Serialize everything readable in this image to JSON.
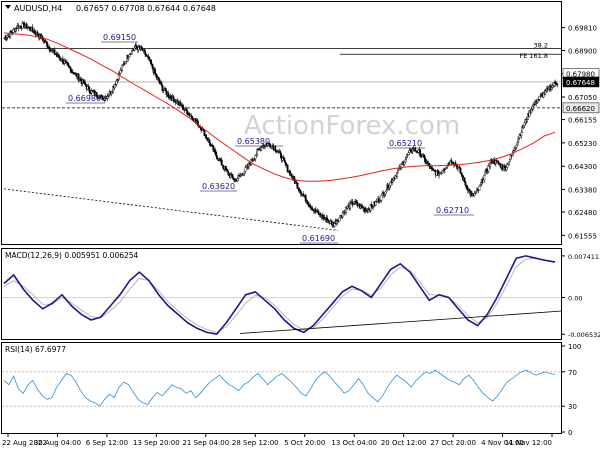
{
  "header": {
    "symbol": "AUDUSD,H4",
    "ohlc": "0.67657 0.67708 0.67644 0.67648"
  },
  "watermark": "ActionForex.com",
  "chart_data": [
    {
      "type": "candlestick",
      "panel": "price",
      "ylim": [
        0.6125,
        0.7035
      ],
      "x_ticks": [
        "22 Aug 2022",
        "30 Aug 04:00",
        "6 Sep 12:00",
        "13 Sep 20:00",
        "21 Sep 04:00",
        "28 Sep 12:00",
        "5 Oct 20:00",
        "13 Oct 04:00",
        "20 Oct 12:00",
        "27 Oct 20:00",
        "4 Nov 04:00",
        "11 Nov 12:00"
      ],
      "y_ticks": [
        "0.69810",
        "0.68900",
        "0.67980",
        "0.67050",
        "0.66155",
        "0.65230",
        "0.64300",
        "0.63380",
        "0.62480",
        "0.61555"
      ],
      "close_series": [
        0.694,
        0.696,
        0.6985,
        0.699,
        0.6975,
        0.6955,
        0.693,
        0.6895,
        0.687,
        0.6845,
        0.6815,
        0.679,
        0.676,
        0.673,
        0.6715,
        0.67,
        0.672,
        0.677,
        0.683,
        0.688,
        0.6905,
        0.689,
        0.685,
        0.679,
        0.674,
        0.671,
        0.669,
        0.6665,
        0.664,
        0.661,
        0.658,
        0.653,
        0.648,
        0.644,
        0.64,
        0.6375,
        0.6395,
        0.643,
        0.647,
        0.651,
        0.652,
        0.6505,
        0.647,
        0.642,
        0.6375,
        0.633,
        0.629,
        0.6255,
        0.6235,
        0.6215,
        0.62,
        0.623,
        0.6265,
        0.6285,
        0.627,
        0.6255,
        0.6275,
        0.63,
        0.634,
        0.638,
        0.642,
        0.6465,
        0.65,
        0.6485,
        0.645,
        0.641,
        0.64,
        0.643,
        0.6455,
        0.642,
        0.636,
        0.631,
        0.6335,
        0.64,
        0.6455,
        0.644,
        0.642,
        0.647,
        0.654,
        0.66,
        0.666,
        0.6695,
        0.672,
        0.6745,
        0.6765
      ],
      "moving_average": [
        0.696,
        0.6956,
        0.6952,
        0.6945,
        0.6935,
        0.6918,
        0.6898,
        0.6878,
        0.6857,
        0.6833,
        0.681,
        0.6783,
        0.6757,
        0.6732,
        0.6707,
        0.6682,
        0.6655,
        0.6626,
        0.6594,
        0.6562,
        0.653,
        0.65,
        0.647,
        0.644,
        0.642,
        0.64,
        0.6385,
        0.6374,
        0.637,
        0.637,
        0.6373,
        0.6378,
        0.6385,
        0.6393,
        0.6402,
        0.6412,
        0.642,
        0.6426,
        0.643,
        0.6432,
        0.6432,
        0.6434,
        0.6436,
        0.644,
        0.6446,
        0.6454,
        0.6465,
        0.648,
        0.65,
        0.6522,
        0.655,
        0.6565
      ],
      "horizontal_lines": [
        {
          "label": "38.2",
          "value": 0.6898,
          "style": "solid"
        },
        {
          "label": "FE 161.8",
          "value": 0.6887,
          "style": "solid"
        },
        {
          "label": "0.66620",
          "value": 0.6662,
          "style": "dashed"
        }
      ],
      "trendline": {
        "style": "dashed",
        "from": [
          "22 Aug 2022",
          0.634
        ],
        "to": [
          "13 Oct 04:00",
          0.6175
        ]
      },
      "price_tags": [
        {
          "label": "0.67980",
          "color": "#ffffff",
          "text_color": "#000000"
        },
        {
          "label": "0.67648",
          "color": "#000000",
          "text_color": "#ffffff"
        },
        {
          "label": "0.66620",
          "color": "#e8e8e8",
          "text_color": "#000000"
        }
      ],
      "annotations": [
        {
          "label": "0.69150",
          "value": 0.6915
        },
        {
          "label": "0.66980",
          "value": 0.6698
        },
        {
          "label": "0.65380",
          "value": 0.6538
        },
        {
          "label": "0.63620",
          "value": 0.6362
        },
        {
          "label": "0.61690",
          "value": 0.6169
        },
        {
          "label": "0.65210",
          "value": 0.6521
        },
        {
          "label": "0.62710",
          "value": 0.6271
        }
      ],
      "colors": {
        "candles": "#000000",
        "moving_average": "#e32424",
        "annotation_text": "#1a1a8c"
      }
    },
    {
      "type": "line",
      "panel": "macd",
      "title": "MACD(12,26,9) 0.005951 0.006254",
      "ylim": [
        -0.0072,
        0.0081
      ],
      "y_ticks": [
        "0.007411",
        "0.00",
        "-0.006532"
      ],
      "series": [
        {
          "values": [
            0.0025,
            0.004,
            0.0015,
            -0.0005,
            -0.002,
            -0.001,
            0.0005,
            -0.0015,
            -0.003,
            -0.004,
            -0.0035,
            -0.0015,
            0.0005,
            0.003,
            0.0045,
            0.003,
            0.0005,
            -0.0015,
            -0.003,
            -0.0045,
            -0.0055,
            -0.0062,
            -0.0065,
            -0.0045,
            -0.002,
            0.0005,
            0.001,
            -0.0005,
            -0.002,
            -0.004,
            -0.0055,
            -0.0062,
            -0.005,
            -0.003,
            -0.001,
            0.001,
            0.002,
            0.0012,
            0.0,
            0.0025,
            0.005,
            0.006,
            0.0045,
            0.002,
            -0.0005,
            0.0005,
            0.0,
            -0.002,
            -0.004,
            -0.005,
            -0.003,
            0.0,
            0.0035,
            0.007,
            0.0074,
            0.007,
            0.0066,
            0.0063
          ]
        },
        {
          "values": [
            0.002,
            0.003,
            0.002,
            0.0005,
            -0.0012,
            -0.0012,
            0.0,
            -0.001,
            -0.0022,
            -0.0034,
            -0.0036,
            -0.0024,
            -0.0008,
            0.0015,
            0.0034,
            0.003,
            0.0012,
            -0.0008,
            -0.0024,
            -0.0038,
            -0.0049,
            -0.0057,
            -0.0062,
            -0.0052,
            -0.0032,
            -0.001,
            0.0004,
            0.0,
            -0.0014,
            -0.0032,
            -0.0048,
            -0.0058,
            -0.0054,
            -0.0038,
            -0.0018,
            0.0002,
            0.0015,
            0.0013,
            0.0004,
            0.0017,
            0.004,
            0.0054,
            0.0048,
            0.0028,
            0.0005,
            0.0004,
            0.0,
            -0.0014,
            -0.0032,
            -0.0045,
            -0.0036,
            -0.001,
            0.0022,
            0.0055,
            0.0068,
            0.007,
            0.0067,
            0.0064
          ]
        }
      ],
      "trendline": {
        "from": [
          "21 Sep 04:00",
          -0.0064
        ],
        "to": [
          "11 Nov 12:00",
          -0.0024
        ]
      },
      "colors": {
        "macd": "#1a1a8c",
        "signal": "#b0b0b0"
      }
    },
    {
      "type": "line",
      "panel": "rsi",
      "title": "RSI(14) 67.6977",
      "ylim": [
        0,
        100
      ],
      "y_ticks": [
        "100",
        "70",
        "30",
        "0"
      ],
      "levels": [
        70,
        30
      ],
      "series": [
        {
          "values": [
            60,
            55,
            65,
            50,
            45,
            55,
            60,
            50,
            42,
            38,
            40,
            52,
            60,
            68,
            66,
            58,
            48,
            40,
            36,
            34,
            30,
            38,
            44,
            40,
            52,
            58,
            55,
            46,
            38,
            34,
            32,
            40,
            46,
            42,
            48,
            55,
            52,
            50,
            45,
            48,
            40,
            45,
            52,
            58,
            62,
            66,
            60,
            55,
            52,
            48,
            55,
            58,
            64,
            68,
            62,
            55,
            60,
            65,
            68,
            63,
            58,
            52,
            45,
            42,
            50,
            60,
            66,
            70,
            65,
            58,
            52,
            45,
            48,
            55,
            62,
            55,
            45,
            40,
            35,
            42,
            52,
            60,
            66,
            62,
            58,
            52,
            60,
            65,
            70,
            68,
            72,
            68,
            64,
            60,
            58,
            55,
            62,
            66,
            60,
            52,
            45,
            40,
            36,
            42,
            50,
            58,
            62,
            66,
            70,
            72,
            69,
            66,
            68,
            70,
            68,
            67
          ]
        }
      ],
      "colors": {
        "rsi": "#2f8fd8"
      }
    }
  ]
}
